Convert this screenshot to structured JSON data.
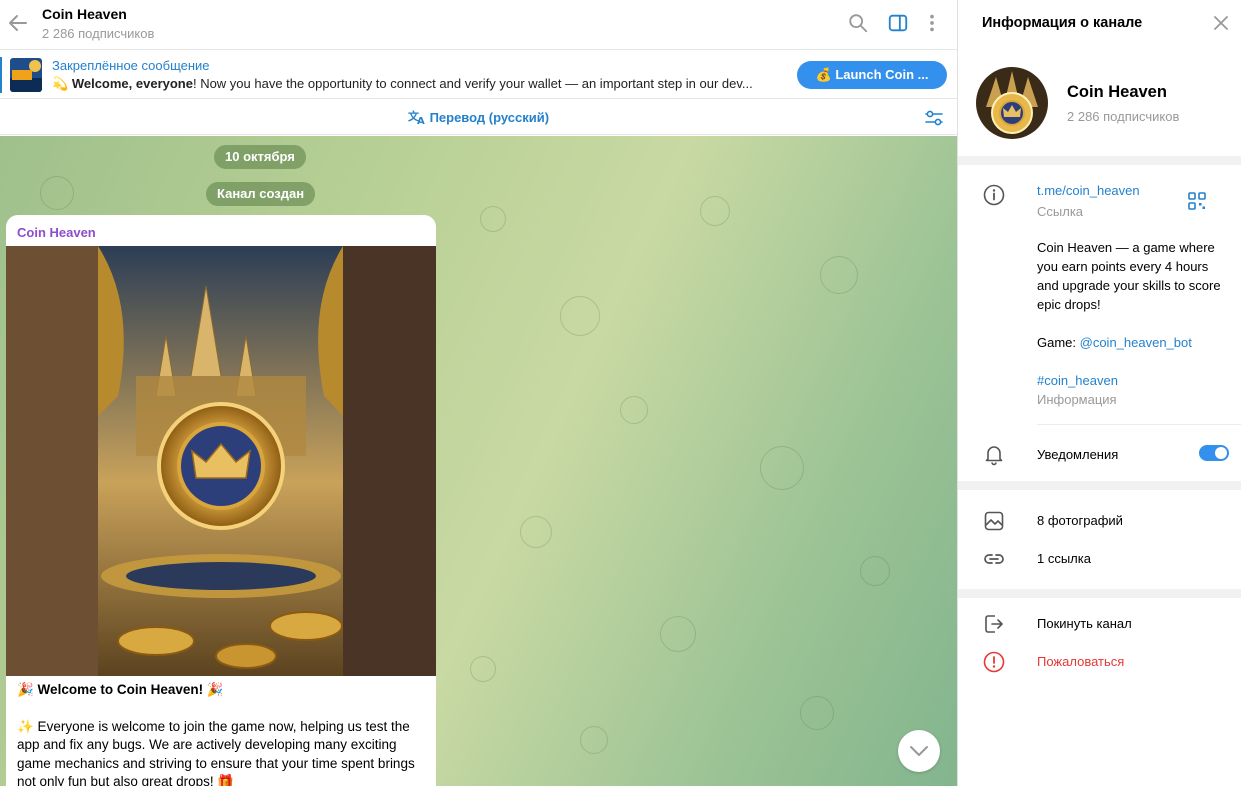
{
  "chat": {
    "title": "Coin Heaven",
    "subscribers": "2 286 подписчиков",
    "pinned": {
      "label": "Закреплённое сообщение",
      "emoji": "💫",
      "bold": "Welcome, everyone",
      "text": "! Now you have the opportunity to connect and verify your wallet — an important step in our dev...",
      "button": "💰 Launch Coin ..."
    },
    "translate_label": "Перевод (русский)",
    "date_pill": "10 октября",
    "created_pill": "Канал создан",
    "post": {
      "author": "Coin Heaven",
      "heading": "🎉 Welcome to Coin Heaven! 🎉",
      "body": "✨ Everyone is welcome to join the game now, helping us test the app and fix any bugs. We are actively developing many exciting game mechanics and striving to ensure that your time spent brings not only fun but also great drops! 🎁"
    }
  },
  "info": {
    "header_title": "Информация о канале",
    "name": "Coin Heaven",
    "subscribers": "2 286 подписчиков",
    "link": "t.me/coin_heaven",
    "link_caption": "Ссылка",
    "about_text": "Coin Heaven — a game where you earn points every 4 hours and upgrade your skills to score epic drops!",
    "game_label": "Game: ",
    "game_link": "@coin_heaven_bot",
    "hashtag": "#coin_heaven",
    "about_caption": "Информация",
    "notifications_label": "Уведомления",
    "notifications_on": true,
    "photos": "8 фотографий",
    "links": "1 ссылка",
    "leave": "Покинуть канал",
    "report": "Пожаловаться"
  },
  "colors": {
    "accent": "#2481cc",
    "button": "#3390ec",
    "author": "#8c4fc9",
    "danger": "#e53935"
  },
  "icons": [
    "back-arrow-icon",
    "search-icon",
    "sidebar-toggle-icon",
    "more-vertical-icon",
    "translate-icon",
    "settings-sliders-icon",
    "chevron-down-icon",
    "close-icon",
    "info-icon",
    "qr-code-icon",
    "bell-icon",
    "photo-icon",
    "link-icon",
    "leave-icon",
    "report-icon"
  ]
}
